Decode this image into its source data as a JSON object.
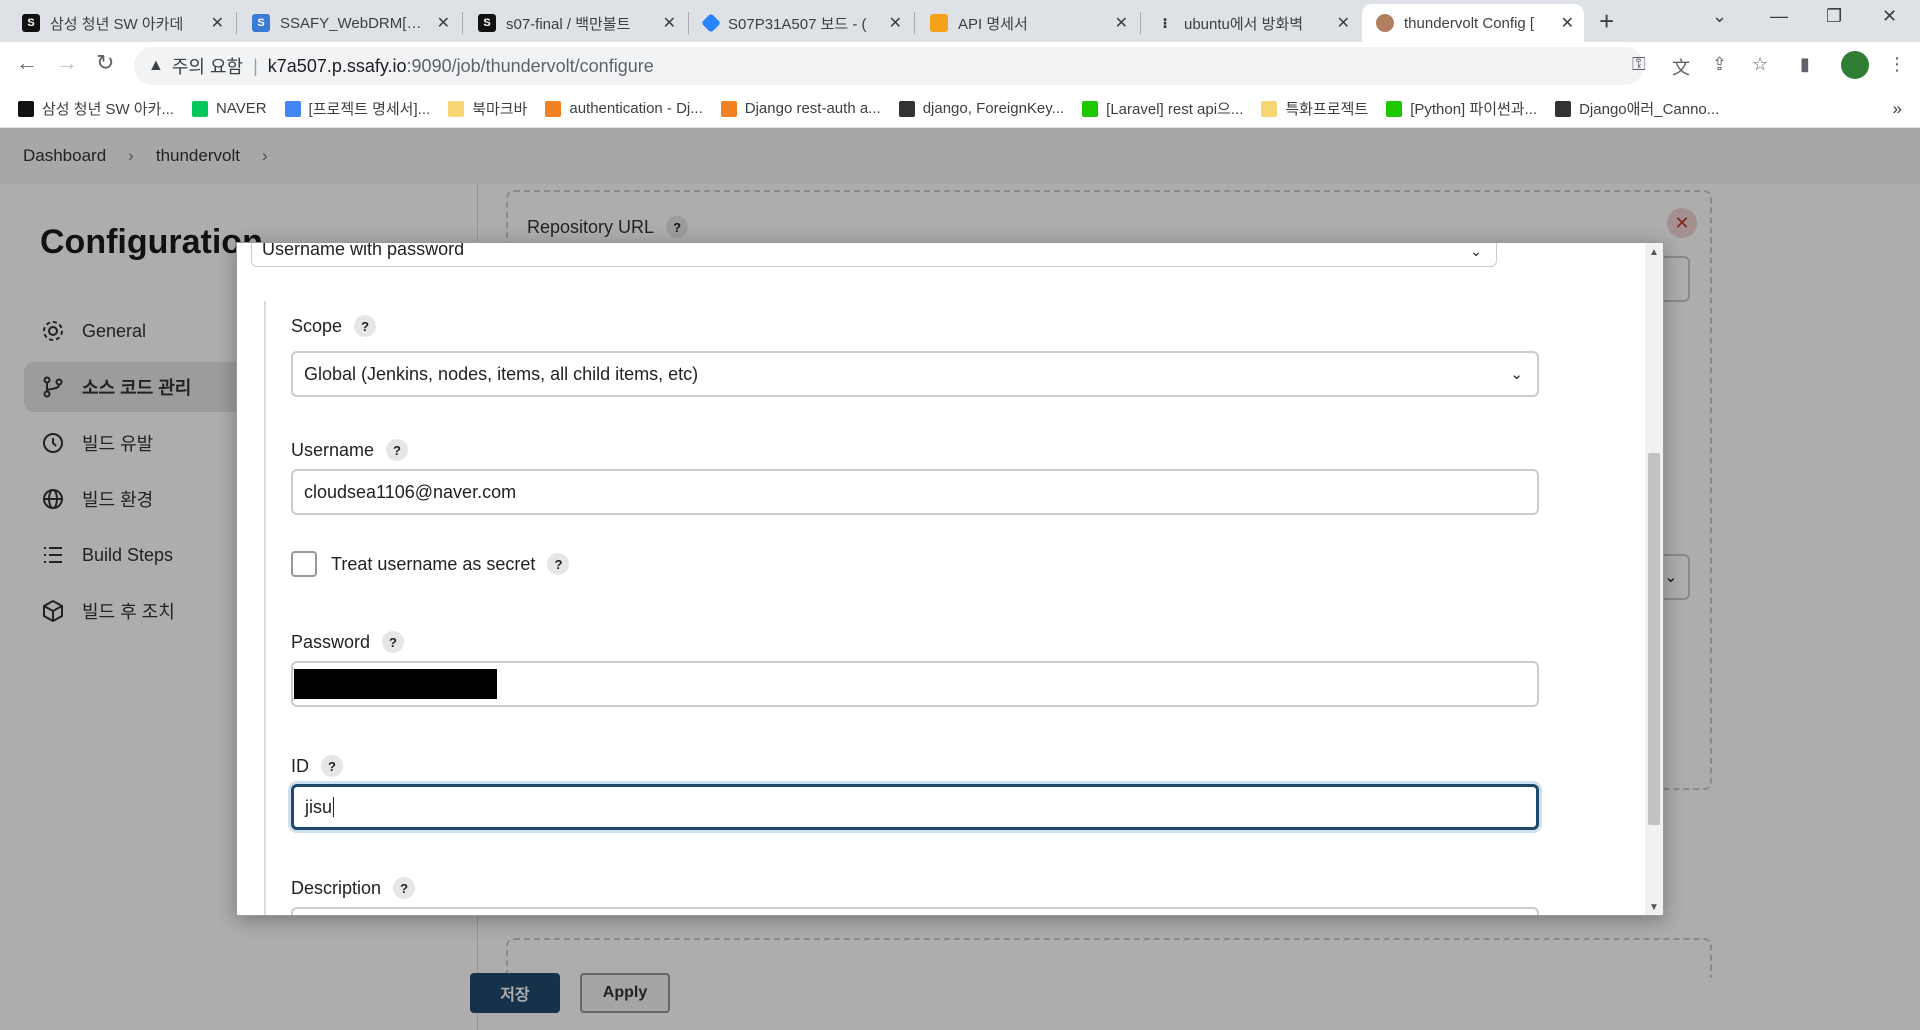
{
  "browser": {
    "tabs": [
      {
        "title": "삼성 청년 SW 아카데",
        "favicon_color": "#111111",
        "active": false
      },
      {
        "title": "SSAFY_WebDRM[xRy]",
        "favicon_color": "#3a7bd5",
        "active": false
      },
      {
        "title": "s07-final / 백만볼트",
        "favicon_color": "#111111",
        "active": false
      },
      {
        "title": "S07P31A507 보드 - (",
        "favicon_color": "#2684ff",
        "active": false
      },
      {
        "title": "API 명세서",
        "favicon_color": "#f4a21a",
        "active": false
      },
      {
        "title": "ubuntu에서 방화벽 ",
        "favicon_color": "#333333",
        "active": false
      },
      {
        "title": "thundervolt Config [",
        "favicon_color": "#b08060",
        "active": true
      }
    ],
    "address": {
      "security_label": "주의 요함",
      "host": "k7a507.p.ssafy.io",
      "path": ":9090/job/thundervolt/configure"
    },
    "bookmarks": [
      {
        "label": "삼성 청년 SW 아카...",
        "color": "#111111"
      },
      {
        "label": "NAVER",
        "color": "#03c75a"
      },
      {
        "label": "[프로젝트 명세서]...",
        "color": "#4285f4"
      },
      {
        "label": "북마크바",
        "color": "#f7d774"
      },
      {
        "label": "authentication - Dj...",
        "color": "#f48024"
      },
      {
        "label": "Django rest-auth a...",
        "color": "#f48024"
      },
      {
        "label": "django, ForeignKey...",
        "color": "#333333"
      },
      {
        "label": "[Laravel] rest api으...",
        "color": "#1ec800"
      },
      {
        "label": "특화프로젝트",
        "color": "#f7d774"
      },
      {
        "label": "[Python] 파이썬과...",
        "color": "#1ec800"
      },
      {
        "label": "Django애러_Canno...",
        "color": "#333333"
      }
    ],
    "more_bookmarks": "»"
  },
  "jenkins": {
    "breadcrumbs": [
      "Dashboard",
      "thundervolt"
    ],
    "page_title": "Configuration",
    "nav": [
      {
        "label": "General",
        "icon": "gear-icon",
        "active": false
      },
      {
        "label": "소스 코드 관리",
        "icon": "branch-icon",
        "active": true
      },
      {
        "label": "빌드 유발",
        "icon": "clock-icon",
        "active": false
      },
      {
        "label": "빌드 환경",
        "icon": "globe-icon",
        "active": false
      },
      {
        "label": "Build Steps",
        "icon": "list-icon",
        "active": false
      },
      {
        "label": "빌드 후 조치",
        "icon": "package-icon",
        "active": false
      }
    ],
    "repository_url_label": "Repository URL",
    "save_label": "저장",
    "apply_label": "Apply"
  },
  "dialog": {
    "kind_value": "Username with password",
    "scope": {
      "label": "Scope",
      "value": "Global (Jenkins, nodes, items, all child items, etc)"
    },
    "username": {
      "label": "Username",
      "value": "cloudsea1106@naver.com"
    },
    "treat_secret": {
      "label": "Treat username as secret",
      "checked": false
    },
    "password": {
      "label": "Password"
    },
    "id": {
      "label": "ID",
      "value": "jisu"
    },
    "description": {
      "label": "Description"
    }
  },
  "help_glyph": "?"
}
